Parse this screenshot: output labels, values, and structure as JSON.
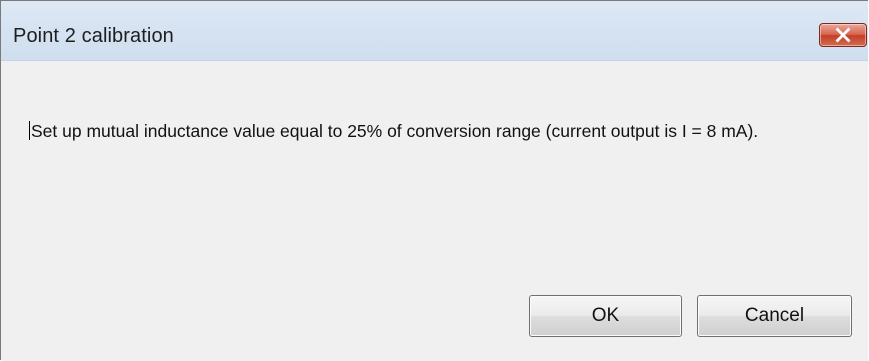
{
  "window": {
    "title": "Point 2 calibration",
    "close_icon": "close-icon"
  },
  "message": {
    "text": "Set up mutual inductance value equal to 25% of conversion range (current output is I = 8 mA)."
  },
  "buttons": {
    "ok_label": "OK",
    "cancel_label": "Cancel"
  },
  "colors": {
    "titlebar": "#d6e3f2",
    "body": "#f0f0f0",
    "close_button": "#c3402a"
  }
}
